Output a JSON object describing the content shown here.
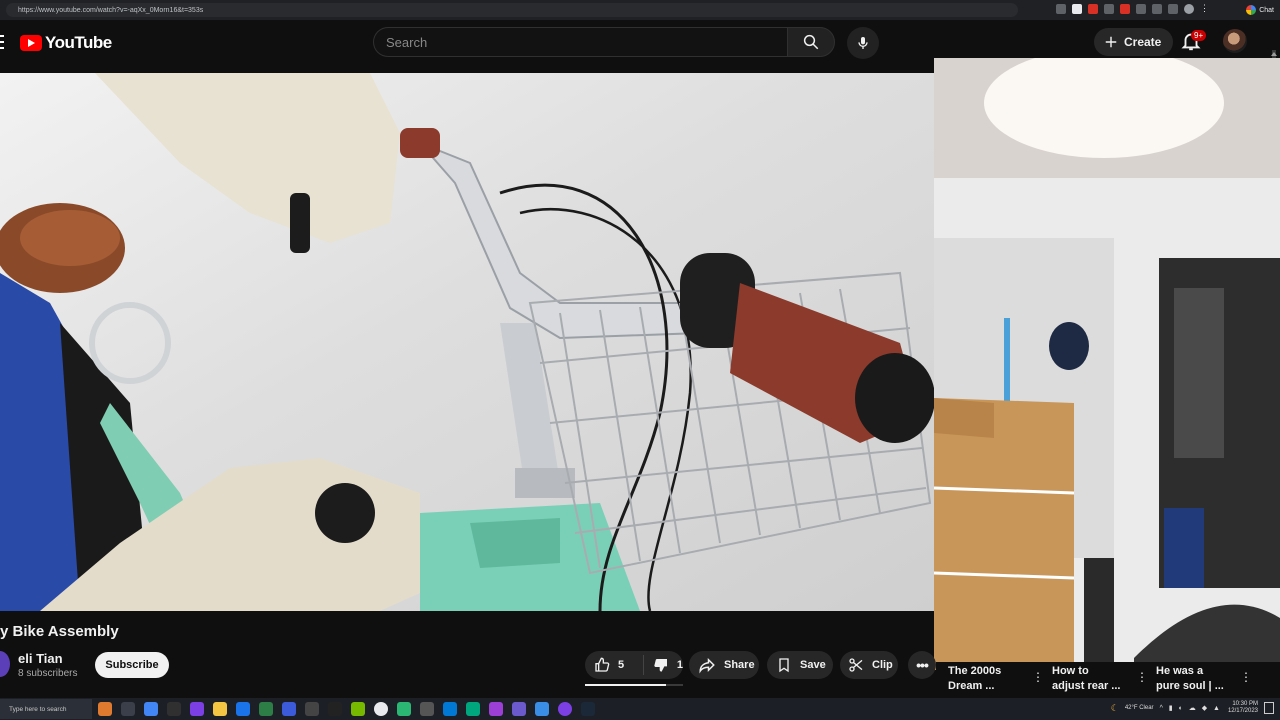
{
  "browser": {
    "url": "https://www.youtube.com/watch?v=-aqXx_0Morn16&t=353s",
    "chat_label": "Chat"
  },
  "header": {
    "logo_text": "YouTube",
    "search_placeholder": "Search",
    "create_label": "Create",
    "notification_badge": "9+"
  },
  "video": {
    "title": "y Bike Assembly",
    "channel_name": "eli Tian",
    "subscribers": "8 subscribers",
    "subscribe_label": "Subscribe",
    "likes": "5",
    "dislikes": "1",
    "share_label": "Share",
    "save_label": "Save",
    "clip_label": "Clip",
    "like_ratio": 0.83
  },
  "recommendations": [
    {
      "title_line1": "The 2000s",
      "title_line2": "Dream ..."
    },
    {
      "title_line1": "How to",
      "title_line2": "adjust rear ..."
    },
    {
      "title_line1": "He was a",
      "title_line2": "pure soul | ..."
    }
  ],
  "taskbar": {
    "search_placeholder": "Type here to search",
    "weather": "42°F Clear",
    "time": "10:30 PM",
    "date": "12/17/2023"
  },
  "colors": {
    "brand_red": "#ff0000",
    "background": "#0f0f0f",
    "pill": "#272727"
  }
}
